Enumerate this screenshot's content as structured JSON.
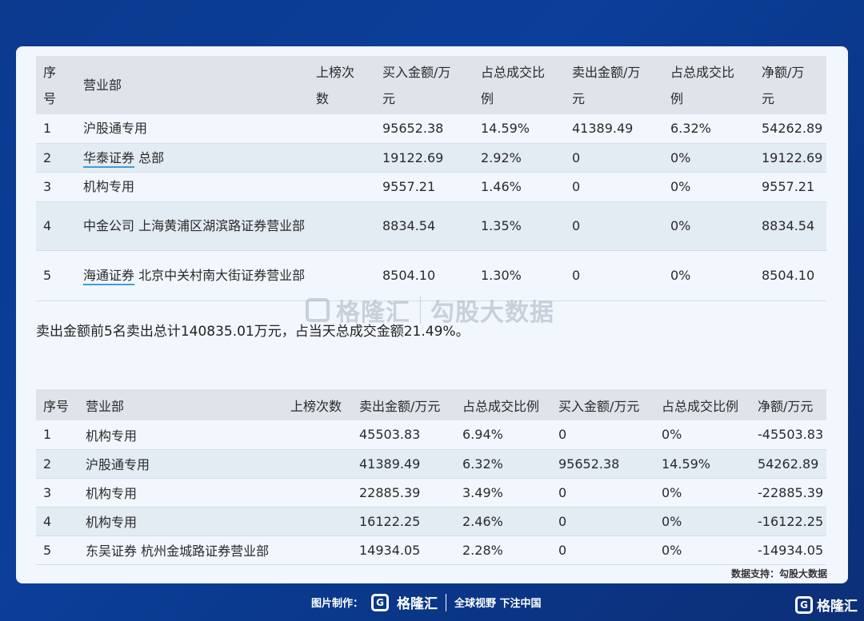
{
  "buy_table": {
    "headers": [
      "序号",
      "营业部",
      "上榜次数",
      "买入金额/万元",
      "占总成交比例",
      "卖出金额/万元",
      "占总成交比例",
      "净额/万元"
    ],
    "header_lines": [
      [
        "序",
        "号"
      ],
      [
        "营业部"
      ],
      [
        "上榜次",
        "数"
      ],
      [
        "买入金额/万",
        "元"
      ],
      [
        "占总成交比",
        "例"
      ],
      [
        "卖出金额/万",
        "元"
      ],
      [
        "占总成交比",
        "例"
      ],
      [
        "净额/万",
        "元"
      ]
    ],
    "rows": [
      {
        "no": "1",
        "broker": "沪股通专用",
        "broker_link": "",
        "count": "",
        "buy": "95652.38",
        "buy_pct": "14.59%",
        "sell": "41389.49",
        "sell_pct": "6.32%",
        "net": "54262.89"
      },
      {
        "no": "2",
        "broker": "总部",
        "broker_link": "华泰证券",
        "count": "",
        "buy": "19122.69",
        "buy_pct": "2.92%",
        "sell": "0",
        "sell_pct": "0%",
        "net": "19122.69"
      },
      {
        "no": "3",
        "broker": "机构专用",
        "broker_link": "",
        "count": "",
        "buy": "9557.21",
        "buy_pct": "1.46%",
        "sell": "0",
        "sell_pct": "0%",
        "net": "9557.21"
      },
      {
        "no": "4",
        "broker": "中金公司 上海黄浦区湖滨路证券营业部",
        "broker_link": "",
        "count": "",
        "buy": "8834.54",
        "buy_pct": "1.35%",
        "sell": "0",
        "sell_pct": "0%",
        "net": "8834.54"
      },
      {
        "no": "5",
        "broker": "北京中关村南大街证券营业部",
        "broker_link": "海通证券",
        "count": "",
        "buy": "8504.10",
        "buy_pct": "1.30%",
        "sell": "0",
        "sell_pct": "0%",
        "net": "8504.10"
      }
    ]
  },
  "summary": "卖出金额前5名卖出总计140835.01万元，占当天总成交金额21.49%。",
  "sell_table": {
    "headers": [
      "序号",
      "营业部",
      "上榜次数",
      "卖出金额/万元",
      "占总成交比例",
      "买入金额/万元",
      "占总成交比例",
      "净额/万元"
    ],
    "rows": [
      {
        "no": "1",
        "broker": "机构专用",
        "count": "",
        "sell": "45503.83",
        "sell_pct": "6.94%",
        "buy": "0",
        "buy_pct": "0%",
        "net": "-45503.83"
      },
      {
        "no": "2",
        "broker": "沪股通专用",
        "count": "",
        "sell": "41389.49",
        "sell_pct": "6.32%",
        "buy": "95652.38",
        "buy_pct": "14.59%",
        "net": "54262.89"
      },
      {
        "no": "3",
        "broker": "机构专用",
        "count": "",
        "sell": "22885.39",
        "sell_pct": "3.49%",
        "buy": "0",
        "buy_pct": "0%",
        "net": "-22885.39"
      },
      {
        "no": "4",
        "broker": "机构专用",
        "count": "",
        "sell": "16122.25",
        "sell_pct": "2.46%",
        "buy": "0",
        "buy_pct": "0%",
        "net": "-16122.25"
      },
      {
        "no": "5",
        "broker": "东吴证券 杭州金城路证券营业部",
        "count": "",
        "sell": "14934.05",
        "sell_pct": "2.28%",
        "buy": "0",
        "buy_pct": "0%",
        "net": "-14934.05"
      }
    ]
  },
  "watermark": {
    "brand": "格隆汇",
    "product": "勾股大数据"
  },
  "source_note": "数据支持：勾股大数据",
  "footer": {
    "made_by": "图片制作：",
    "brand": "格隆汇",
    "slogan": "全球视野 下注中国"
  },
  "corner_brand": "格隆汇",
  "colors": {
    "background": "#0b3a8f",
    "card": "#f1f7fd",
    "header_row": "#dfe4ea",
    "stripe_row": "#e3ebf3",
    "link_underline": "#3aa0d8"
  },
  "icons": {
    "logo": "gelonghui-logo-icon"
  }
}
